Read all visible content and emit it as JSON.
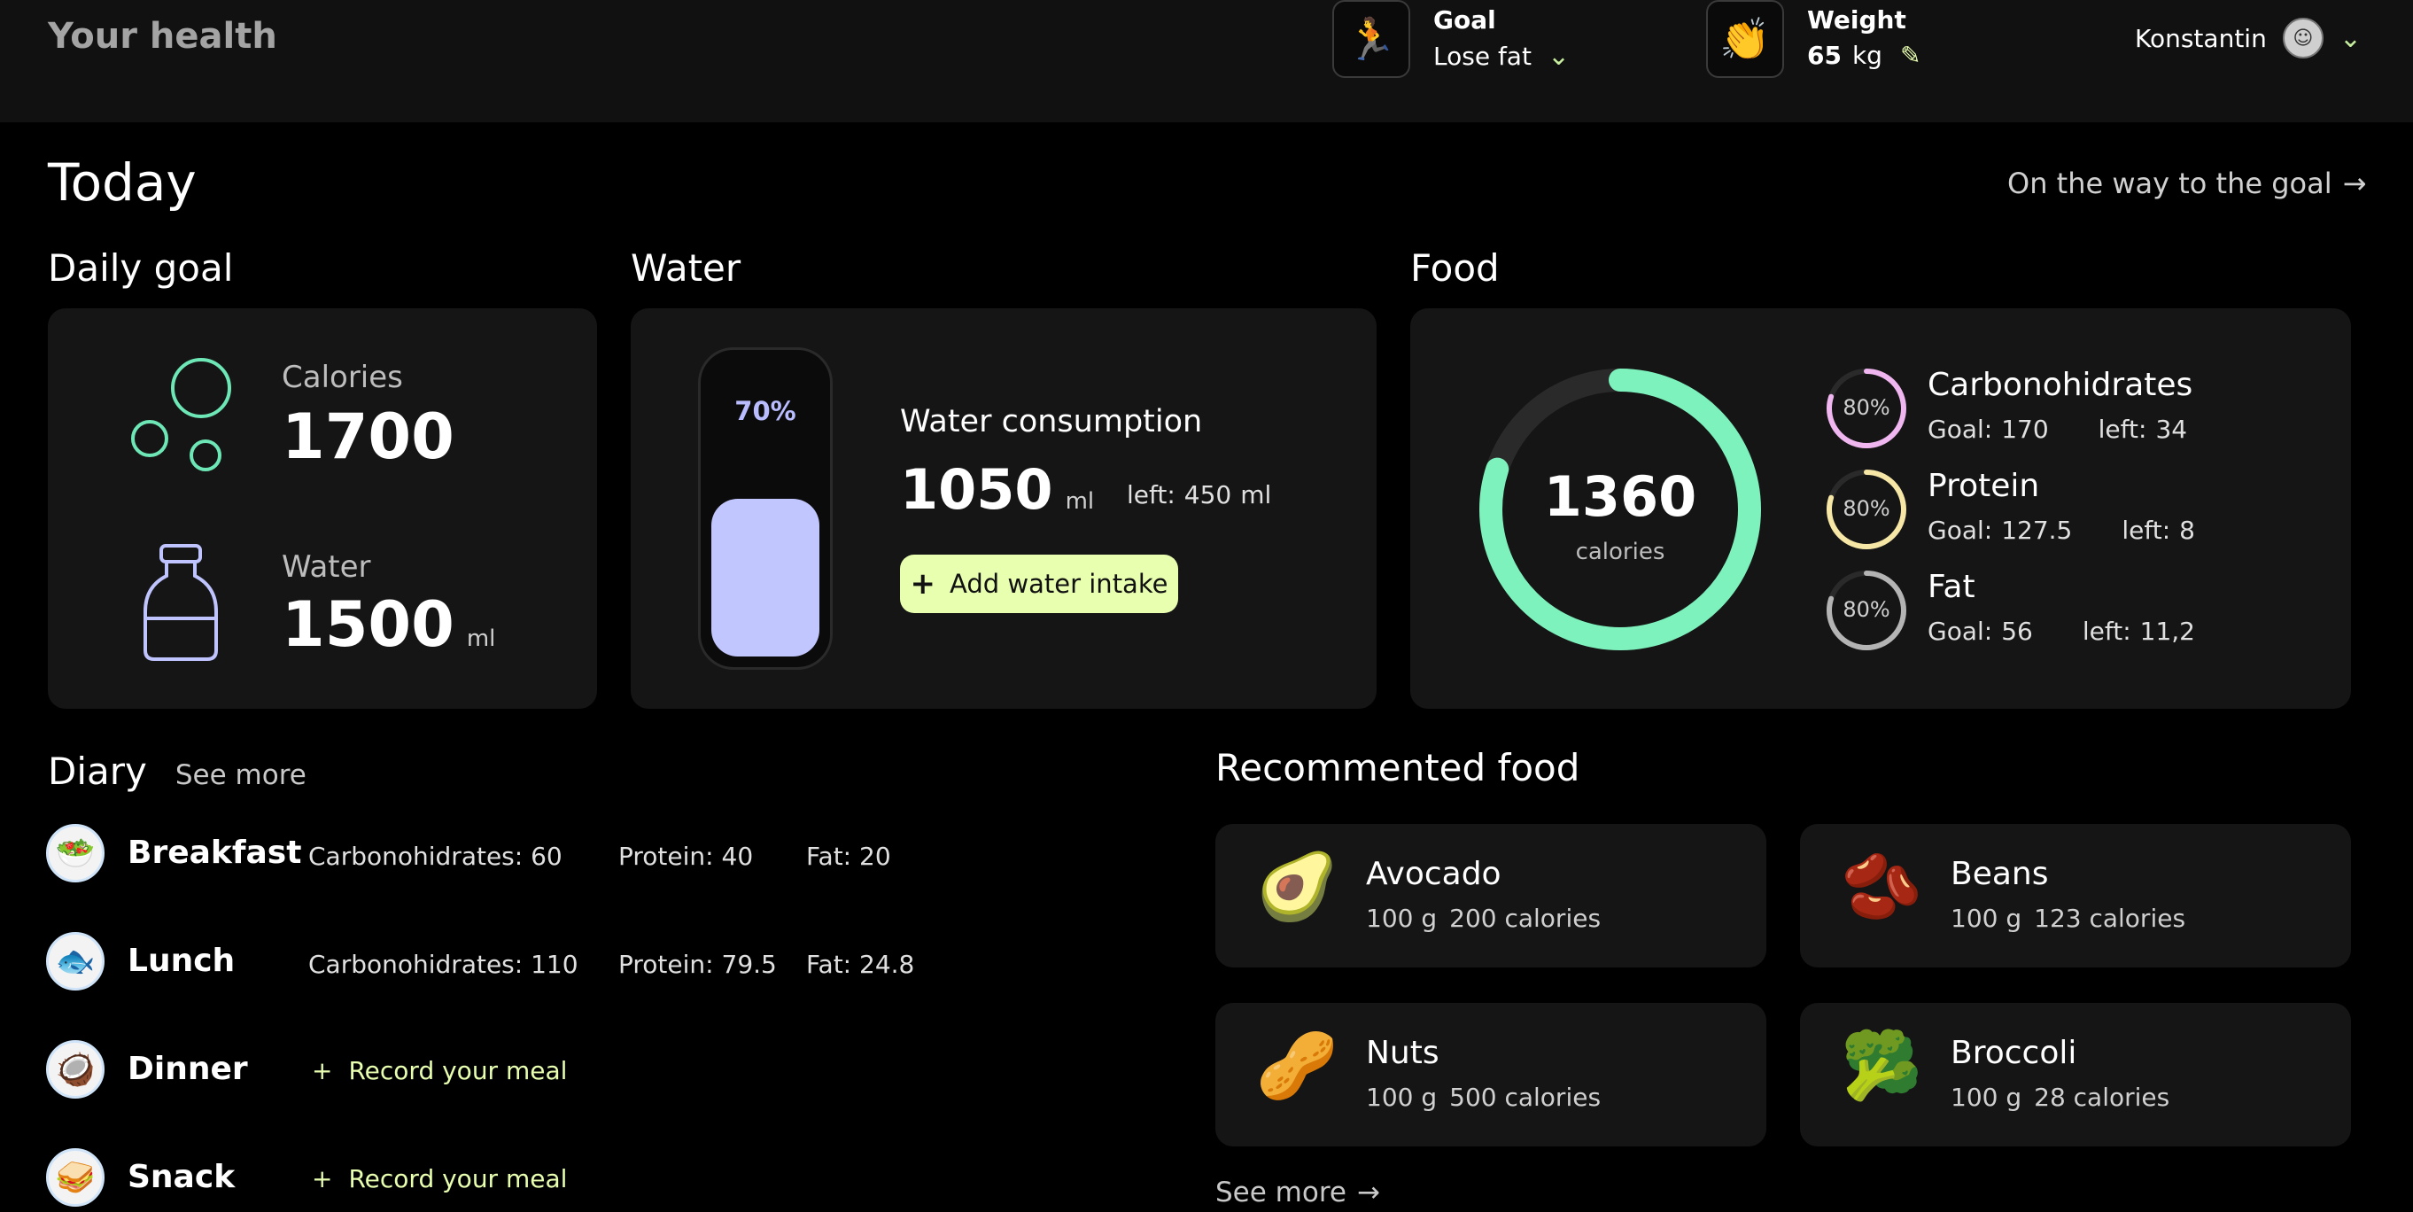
{
  "header": {
    "brand": "Your health",
    "goal_label": "Goal",
    "goal_value": "Lose fat",
    "weight_label": "Weight",
    "weight_value": "65",
    "weight_unit": "kg",
    "user_name": "Konstantin",
    "icons": {
      "goal": "runner-icon",
      "weight": "clap-icon",
      "edit": "pencil-icon",
      "dropdown": "chevron-down-icon"
    }
  },
  "today": {
    "title": "Today",
    "goal_link": "On the way to the goal"
  },
  "daily_goal": {
    "title": "Daily goal",
    "calories_label": "Calories",
    "calories_value": "1700",
    "water_label": "Water",
    "water_value": "1500",
    "water_unit": "ml",
    "accent": "#6ee7b7",
    "bottle_color": "#bfc4ff"
  },
  "water": {
    "title": "Water",
    "percent_label": "70%",
    "fill_fraction": 0.7,
    "consumption_label": "Water consumption",
    "consumption_value": "1050",
    "consumption_unit": "ml",
    "left_label": "left:",
    "left_value": "450",
    "left_unit": "ml",
    "add_button": "Add water intake",
    "fill_color": "#c1c6ff"
  },
  "food": {
    "title": "Food",
    "total_value": "1360",
    "total_unit": "calories",
    "total_fraction": 0.8,
    "ring_color": "#7ef2bd",
    "macros": [
      {
        "name": "Carbonohidrates",
        "percent": "80%",
        "fraction": 0.8,
        "goal_label": "Goal:",
        "goal": "170",
        "left_label": "left:",
        "left": "34",
        "color": "#f0b6f0"
      },
      {
        "name": "Protein",
        "percent": "80%",
        "fraction": 0.8,
        "goal_label": "Goal:",
        "goal": "127.5",
        "left_label": "left:",
        "left": "8",
        "color": "#f7e7a6"
      },
      {
        "name": "Fat",
        "percent": "80%",
        "fraction": 0.8,
        "goal_label": "Goal:",
        "goal": "56",
        "left_label": "left:",
        "left": "11,2",
        "color": "#b4b4b4"
      }
    ]
  },
  "diary": {
    "title": "Diary",
    "see_more": "See more",
    "meals": [
      {
        "name": "Breakfast",
        "icon": "salad-icon",
        "carbs_label": "Carbonohidrates:",
        "carbs": "60",
        "protein_label": "Protein:",
        "protein": "40",
        "fat_label": "Fat:",
        "fat": "20"
      },
      {
        "name": "Lunch",
        "icon": "fish-icon",
        "carbs_label": "Carbonohidrates:",
        "carbs": "110",
        "protein_label": "Protein:",
        "protein": "79.5",
        "fat_label": "Fat:",
        "fat": "24.8"
      },
      {
        "name": "Dinner",
        "icon": "dinner-icon",
        "record": "Record your meal"
      },
      {
        "name": "Snack",
        "icon": "snack-icon",
        "record": "Record your meal"
      }
    ]
  },
  "recommended": {
    "title": "Recommented food",
    "see_more": "See more",
    "items": [
      {
        "name": "Avocado",
        "amount": "100 g",
        "calories": "200 calories",
        "icon": "avocado-icon"
      },
      {
        "name": "Beans",
        "amount": "100 g",
        "calories": "123 calories",
        "icon": "beans-icon"
      },
      {
        "name": "Nuts",
        "amount": "100 g",
        "calories": "500 calories",
        "icon": "peanut-icon"
      },
      {
        "name": "Broccoli",
        "amount": "100 g",
        "calories": "28 calories",
        "icon": "broccoli-icon"
      }
    ]
  }
}
